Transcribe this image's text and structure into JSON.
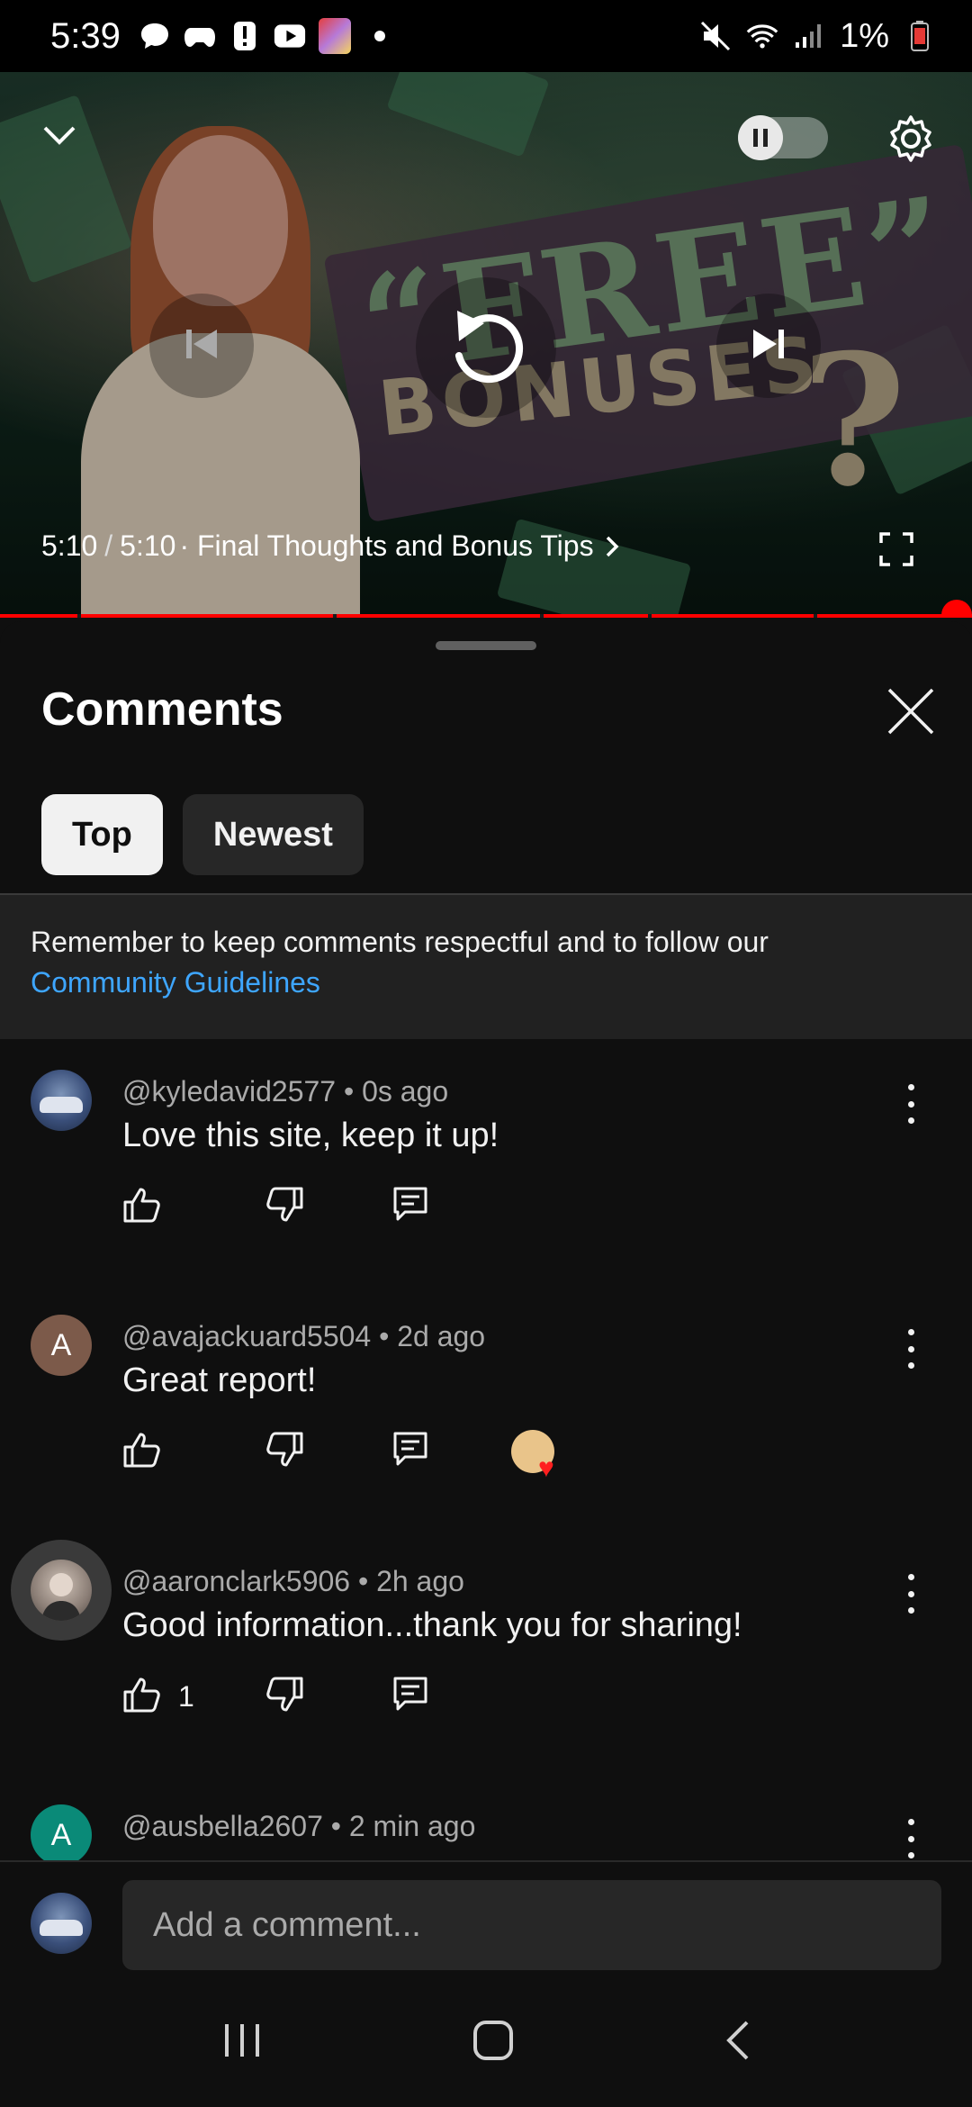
{
  "status_bar": {
    "time": "5:39",
    "battery_percent": "1%",
    "battery_level": 0.01
  },
  "player": {
    "thumbnail_text_main": "“FREE”",
    "thumbnail_text_sub": "BONUSES",
    "thumbnail_text_mark": "?",
    "current_time": "5:10",
    "separator": "/",
    "duration": "5:10",
    "chapter": "· Final Thoughts and Bonus Tips",
    "progress": 1.0,
    "autoplay_on": false
  },
  "comments_sheet": {
    "title": "Comments",
    "sort_chips": [
      {
        "label": "Top",
        "selected": true
      },
      {
        "label": "Newest",
        "selected": false
      }
    ],
    "notice_text": "Remember to keep comments respectful and to follow our",
    "notice_link": "Community Guidelines",
    "comments": [
      {
        "author": "@kyledavid2577",
        "age": "0s ago",
        "text": "Love this site, keep it up!",
        "likes": "",
        "avatar_letter": "",
        "creator_hearted": false
      },
      {
        "author": "@avajackuard5504",
        "age": "2d ago",
        "text": "Great report!",
        "likes": "",
        "avatar_letter": "A",
        "creator_hearted": true
      },
      {
        "author": "@aaronclark5906",
        "age": "2h ago",
        "text": "Good information...thank you for sharing!",
        "likes": "1",
        "avatar_letter": "",
        "creator_hearted": false
      },
      {
        "author": "@ausbella2607",
        "age": "2 min ago",
        "text": "",
        "likes": "",
        "avatar_letter": "A",
        "creator_hearted": false
      }
    ],
    "add_comment_placeholder": "Add a comment..."
  },
  "colors": {
    "background": "#0f0f0f",
    "accent_red": "#ff0000",
    "link_blue": "#3ea6ff",
    "secondary_text": "#aaaaaa",
    "chip_inactive": "#272727"
  },
  "icons": {
    "collapse": "chevron-down-icon",
    "settings": "gear-icon",
    "previous": "skip-previous-icon",
    "replay": "replay-icon",
    "next": "skip-next-icon",
    "fullscreen": "fullscreen-icon",
    "close": "close-icon",
    "like": "thumbs-up-icon",
    "dislike": "thumbs-down-icon",
    "reply": "reply-icon",
    "more": "more-vert-icon"
  }
}
